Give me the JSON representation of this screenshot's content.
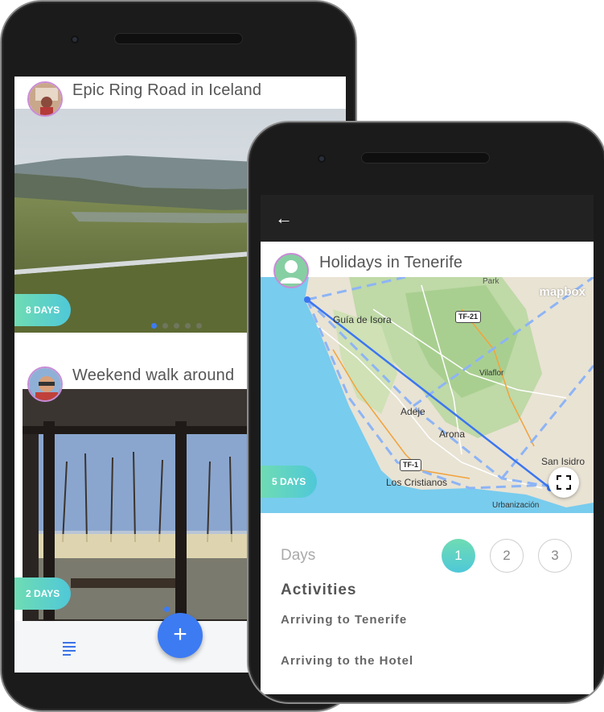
{
  "feed": {
    "trips": [
      {
        "title": "Epic Ring Road in Iceland",
        "days_badge": "8 DAYS"
      },
      {
        "title": "Weekend walk around",
        "days_badge": "2 DAYS"
      }
    ]
  },
  "bottombar": {
    "menu_icon": "list-icon",
    "fab_label": "+"
  },
  "detail": {
    "back_icon": "←",
    "title": "Holidays in Tenerife",
    "days_badge": "5 DAYS",
    "map": {
      "attribution": "mapbox",
      "labels": {
        "park": "Park",
        "guia": "Guía de Isora",
        "vilaflor": "Vilaflor",
        "adeje": "Adeje",
        "arona": "Arona",
        "san_isidro": "San Isidro",
        "los_cristianos": "Los Cristianos",
        "urbanizacion": "Urbanización"
      },
      "road_shields": {
        "tf21": "TF-21",
        "tf1": "TF-1"
      }
    },
    "days_label": "Days",
    "day_options": [
      "1",
      "2",
      "3"
    ],
    "selected_day": "1",
    "activities_title": "Activities",
    "activities": [
      "Arriving to Tenerife",
      "Arriving to the Hotel"
    ]
  },
  "colors": {
    "accent": "#3d7bf3",
    "badge_gradient_start": "#6fdcb3",
    "badge_gradient_end": "#4fc8d8",
    "topbar": "#222222"
  }
}
